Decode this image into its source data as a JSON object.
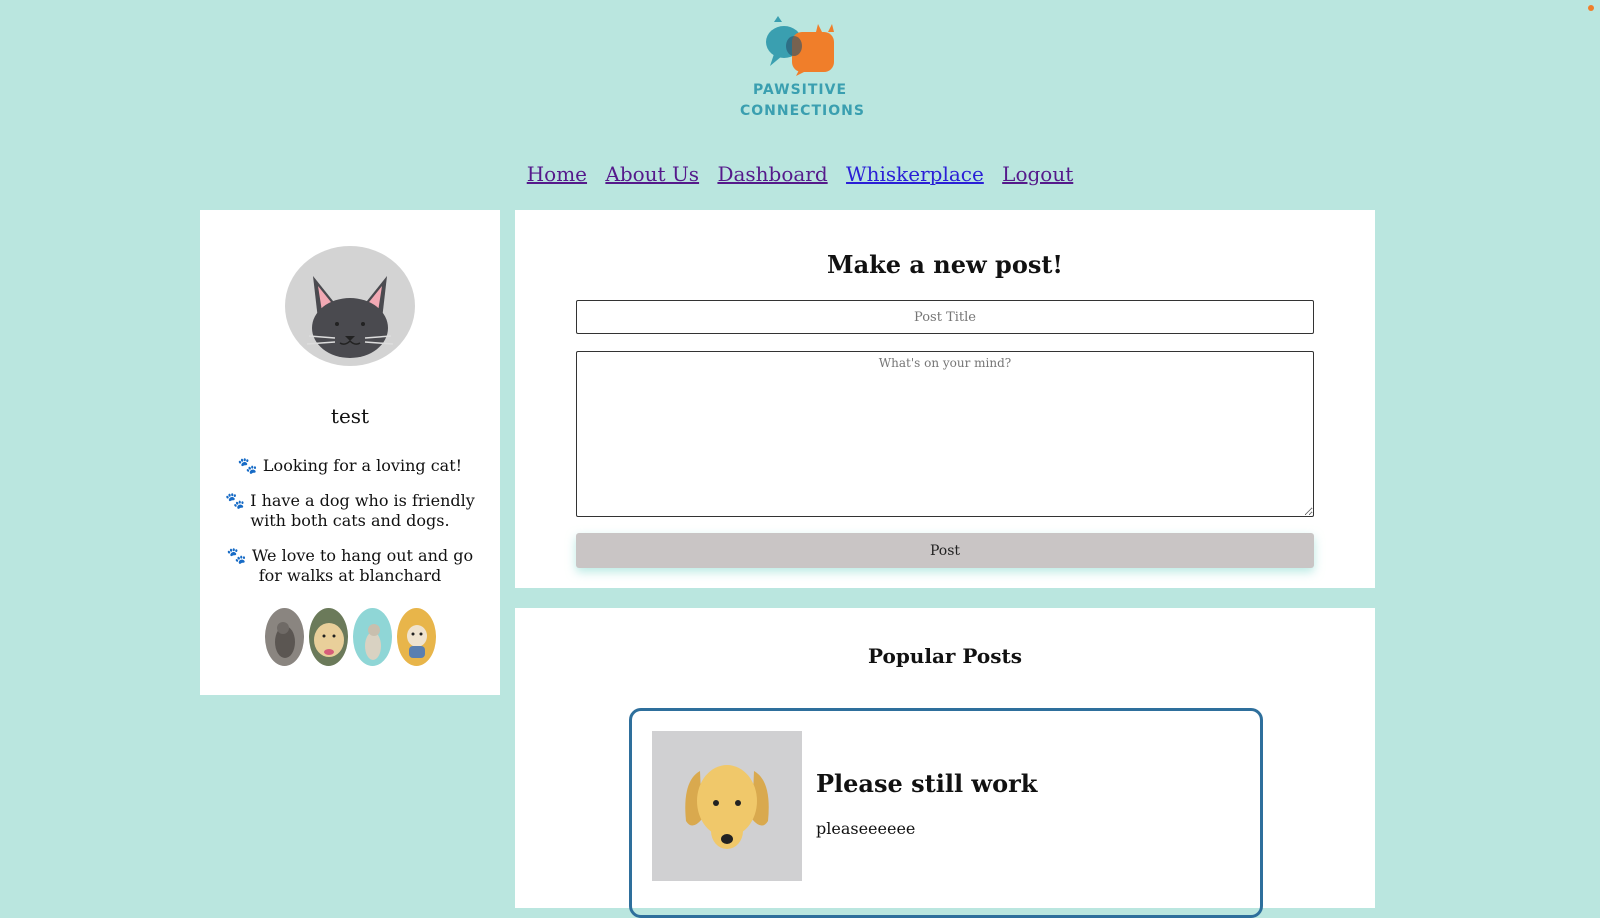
{
  "brand": {
    "line1": "PAWSITIVE",
    "line2": "CONNECTIONS",
    "accent": "#f07e2a",
    "primary": "#3a9fb0"
  },
  "nav": {
    "items": [
      {
        "label": "Home"
      },
      {
        "label": "About Us"
      },
      {
        "label": "Dashboard"
      },
      {
        "label": "Whiskerplace"
      },
      {
        "label": "Logout"
      }
    ]
  },
  "profile": {
    "avatar_icon": "cat-face-icon",
    "username": "test",
    "bio": [
      "🐾 Looking for a loving cat!",
      "🐾 I have a dog who is friendly with both cats and dogs.",
      "🐾 We love to hang out and go for walks at blanchard"
    ],
    "pets": [
      {
        "name": "cat-photo-1"
      },
      {
        "name": "dog-photo-golden"
      },
      {
        "name": "cat-photo-2"
      },
      {
        "name": "dog-photo-small"
      }
    ]
  },
  "new_post": {
    "heading": "Make a new post!",
    "title_placeholder": "Post Title",
    "body_placeholder": "What's on your mind?",
    "submit_label": "Post"
  },
  "popular": {
    "heading": "Popular Posts",
    "posts": [
      {
        "title": "Please still work",
        "body": "pleaseeeeee",
        "thumb_icon": "dog-face-icon"
      }
    ]
  }
}
